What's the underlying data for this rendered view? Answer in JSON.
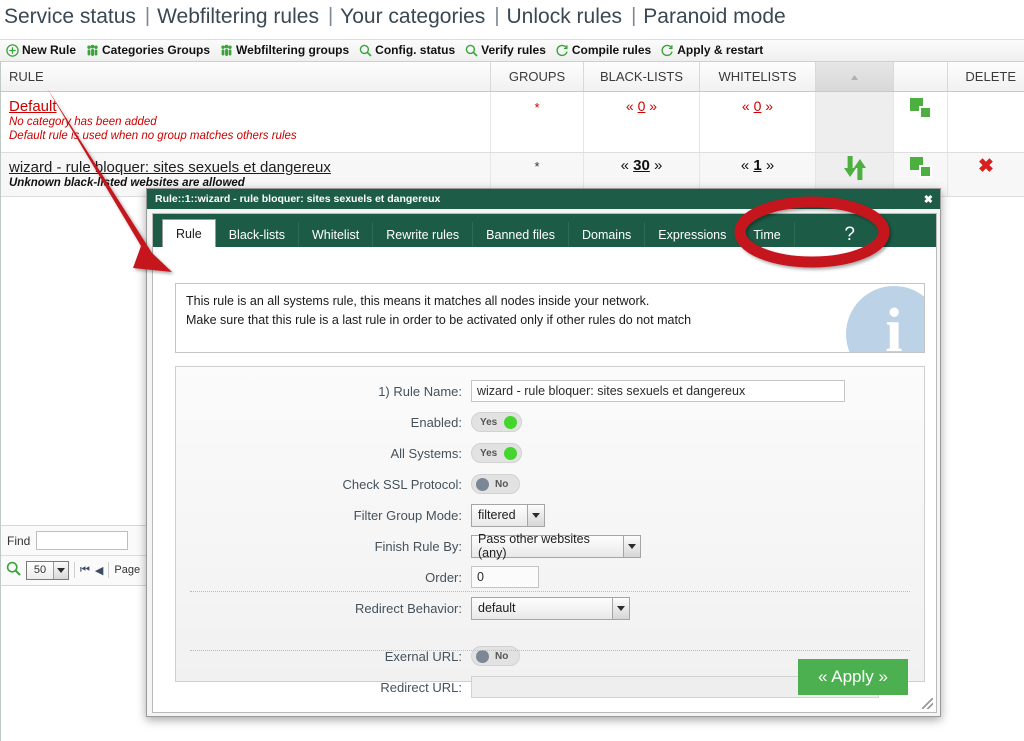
{
  "topnav": {
    "links": [
      "Service status",
      "Webfiltering rules",
      "Your categories",
      "Unlock rules",
      "Paranoid mode"
    ],
    "separator": "|"
  },
  "toolbar": {
    "items": [
      {
        "label": "New Rule",
        "icon": "plus-circle-icon"
      },
      {
        "label": "Categories Groups",
        "icon": "group-icon"
      },
      {
        "label": "Webfiltering groups",
        "icon": "group-icon"
      },
      {
        "label": "Config. status",
        "icon": "search-icon"
      },
      {
        "label": "Verify rules",
        "icon": "search-icon"
      },
      {
        "label": "Compile rules",
        "icon": "refresh-icon"
      },
      {
        "label": "Apply & restart",
        "icon": "refresh-icon"
      }
    ]
  },
  "grid": {
    "columns": [
      "RULE",
      "GROUPS",
      "BLACK-LISTS",
      "WHITELISTS",
      "",
      "",
      "DELETE"
    ],
    "rows": [
      {
        "name": "Default",
        "notes": [
          "No category has been added",
          "Default rule is used when no group matches others rules"
        ],
        "groups": "*",
        "blacklists": "0",
        "whitelists": "0",
        "move": "",
        "copy": "copy-icon",
        "delete": ""
      },
      {
        "name": "wizard - rule bloquer: sites sexuels et dangereux",
        "notes": [
          "Unknown black-listed websites are allowed"
        ],
        "groups": "*",
        "blacklists": "30",
        "whitelists": "1",
        "move": "move-updown-icon",
        "copy": "copy-icon",
        "delete": "delete-x-icon"
      }
    ],
    "quote_open": "«",
    "quote_close": "»"
  },
  "findbar": {
    "find_label": "Find",
    "find_value": "",
    "find_placeholder": "",
    "search_icon": "search-icon",
    "page_size": "50",
    "first_icon": "first-page-icon",
    "prev_icon": "prev-page-icon",
    "page_label": "Page"
  },
  "dialog": {
    "title": "Rule::1::wizard - rule bloquer: sites sexuels et dangereux",
    "close_label": "✖",
    "tabs": [
      {
        "label": "Rule",
        "active": true
      },
      {
        "label": "Black-lists",
        "active": false
      },
      {
        "label": "Whitelist",
        "active": false
      },
      {
        "label": "Rewrite rules",
        "active": false
      },
      {
        "label": "Banned files",
        "active": false
      },
      {
        "label": "Domains",
        "active": false
      },
      {
        "label": "Expressions",
        "active": false
      },
      {
        "label": "Time",
        "active": false
      }
    ],
    "help_tab_label": "?",
    "info": {
      "line1": "This rule is an all systems rule, this means it matches all nodes inside your network.",
      "line2": "Make sure that this rule is a last rule in order to be activated only if other rules do not match",
      "glyph": "i"
    },
    "form": {
      "rule_name_label": "1) Rule Name:",
      "rule_name_value": "wizard - rule bloquer: sites sexuels et dangereux",
      "enabled_label": "Enabled:",
      "enabled_value": "Yes",
      "all_systems_label": "All Systems:",
      "all_systems_value": "Yes",
      "check_ssl_label": "Check SSL Protocol:",
      "check_ssl_value": "No",
      "filter_group_mode_label": "Filter Group Mode:",
      "filter_group_mode_value": "filtered",
      "finish_rule_by_label": "Finish Rule By:",
      "finish_rule_by_value": "Pass other websites (any)",
      "order_label": "Order:",
      "order_value": "0",
      "redirect_behavior_label": "Redirect Behavior:",
      "redirect_behavior_value": "default",
      "external_url_label": "Exernal URL:",
      "external_url_value": "No",
      "redirect_url_label": "Redirect URL:",
      "redirect_url_value": ""
    },
    "apply_label": "« Apply »"
  },
  "annotations": {
    "arrow": "red-arrow-annotation",
    "ellipse": "red-ellipse-annotation"
  },
  "colors": {
    "brand_green": "#1c5c46",
    "accent_green": "#4caf3f",
    "apply_green": "#4cb050",
    "alert_red": "#cc0000",
    "annotation_red": "#c00000",
    "toggle_on": "#44d62c",
    "toggle_off": "#7b8795"
  }
}
